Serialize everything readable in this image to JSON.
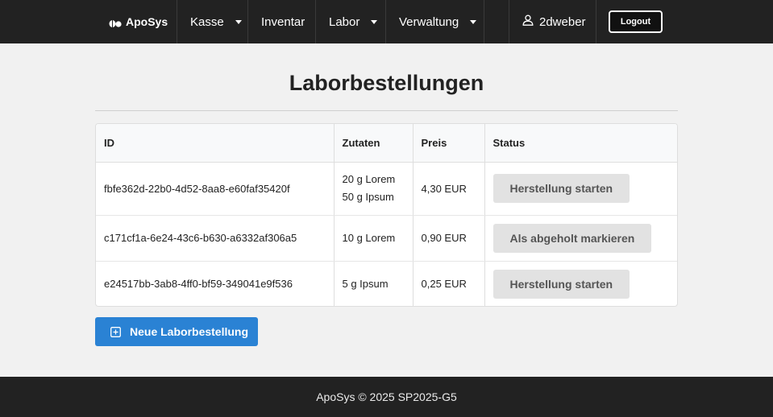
{
  "navbar": {
    "brand": "ApoSys",
    "items": [
      {
        "label": "Kasse",
        "dropdown": true
      },
      {
        "label": "Inventar",
        "dropdown": false
      },
      {
        "label": "Labor",
        "dropdown": true
      },
      {
        "label": "Verwaltung",
        "dropdown": true
      }
    ],
    "user": "2dweber",
    "logout_label": "Logout"
  },
  "main": {
    "title": "Laborbestellungen",
    "table": {
      "headers": [
        "ID",
        "Zutaten",
        "Preis",
        "Status"
      ],
      "rows": [
        {
          "id": "fbfe362d-22b0-4d52-8aa8-e60faf35420f",
          "zutaten": [
            "20 g Lorem",
            "50 g Ipsum"
          ],
          "preis": "4,30 EUR",
          "status_action": "Herstellung starten"
        },
        {
          "id": "c171cf1a-6e24-43c6-b630-a6332af306a5",
          "zutaten": [
            "10 g Lorem"
          ],
          "preis": "0,90 EUR",
          "status_action": "Als abgeholt markieren"
        },
        {
          "id": "e24517bb-3ab8-4ff0-bf59-349041e9f536",
          "zutaten": [
            "5 g Ipsum"
          ],
          "preis": "0,25 EUR",
          "status_action": "Herstellung starten"
        }
      ]
    },
    "new_button_label": "Neue Laborbestellung"
  },
  "footer": {
    "text": "ApoSys © 2025 SP2025-G5"
  },
  "colors": {
    "navbar_bg": "#222222",
    "primary_button": "#2a82d4",
    "status_button_bg": "#e2e2e2"
  }
}
